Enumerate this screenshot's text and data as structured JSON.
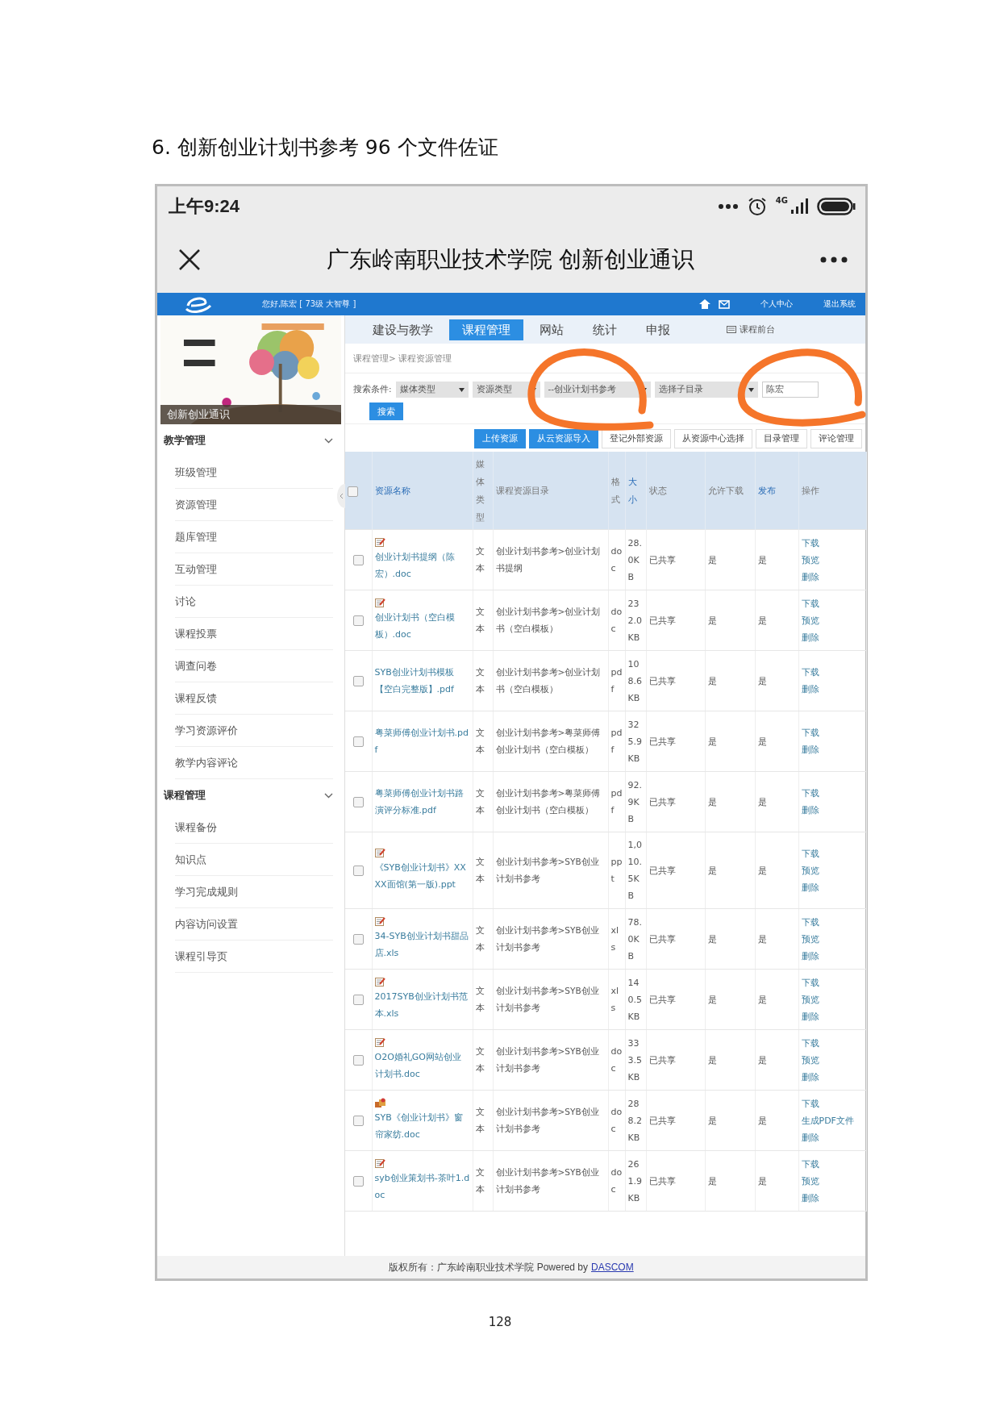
{
  "document_heading": "6. 创新创业计划书参考 96 个文件佐证",
  "status_bar": {
    "time": "上午9:24",
    "network": "4G"
  },
  "title_bar": {
    "title": "广东岭南职业技术学院 创新创业通识"
  },
  "site_header": {
    "greeting": "您好,陈宏 [ 73级 大智尊 ]",
    "links": [
      "个人中心",
      "退出系统"
    ]
  },
  "sidebar": {
    "banner_label": "创新创业通识",
    "sections": [
      {
        "title": "教学管理",
        "expanded": true,
        "items": [
          "班级管理",
          "资源管理",
          "题库管理",
          "互动管理",
          "讨论",
          "课程投票",
          "调查问卷",
          "课程反馈",
          "学习资源评价",
          "教学内容评论"
        ]
      },
      {
        "title": "课程管理",
        "expanded": true,
        "items": [
          "课程备份",
          "知识点",
          "学习完成规则",
          "内容访问设置",
          "课程引导页"
        ]
      }
    ]
  },
  "nav_tabs": [
    {
      "label": "建设与教学",
      "selected": false
    },
    {
      "label": "课程管理",
      "selected": true
    },
    {
      "label": "网站",
      "selected": false
    },
    {
      "label": "统计",
      "selected": false
    },
    {
      "label": "申报",
      "selected": false
    }
  ],
  "front_link": "课程前台",
  "breadcrumb": "课程管理> 课程资源管理",
  "search": {
    "label": "搜索条件:",
    "selects": [
      "媒体类型",
      "资源类型",
      "--创业计划书参考",
      "选择子目录"
    ],
    "keyword": "陈宏",
    "button": "搜索"
  },
  "actions": [
    {
      "label": "上传资源",
      "kind": "primary"
    },
    {
      "label": "从云资源导入",
      "kind": "primary"
    },
    {
      "label": "登记外部资源",
      "kind": "default"
    },
    {
      "label": "从资源中心选择",
      "kind": "default"
    },
    {
      "label": "目录管理",
      "kind": "default"
    },
    {
      "label": "评论管理",
      "kind": "default"
    }
  ],
  "table": {
    "all_checked": false,
    "columns": [
      {
        "label": "资源名称",
        "kind": "link"
      },
      {
        "label": "媒体类型",
        "kind": "plain"
      },
      {
        "label": "课程资源目录",
        "kind": "plain"
      },
      {
        "label": "格式",
        "kind": "plain"
      },
      {
        "label": "大小",
        "kind": "link"
      },
      {
        "label": "状态",
        "kind": "plain"
      },
      {
        "label": "允许下载",
        "kind": "plain"
      },
      {
        "label": "发布",
        "kind": "link"
      },
      {
        "label": "操作",
        "kind": "plain"
      }
    ],
    "rows": [
      {
        "checked": false,
        "kind": "annotated",
        "name": "创业计划书提纲（陈宏）.doc",
        "media": "文本",
        "directory": "创业计划书参考>创业计划书提纲",
        "format": "doc",
        "size": "28.0KB",
        "status": "已共享",
        "allow_download": "是",
        "published": "是",
        "ops": [
          "下载",
          "预览",
          "删除"
        ]
      },
      {
        "checked": false,
        "kind": "annotated",
        "name": "创业计划书（空白模板）.doc",
        "media": "文本",
        "directory": "创业计划书参考>创业计划书（空白模板）",
        "format": "doc",
        "size": "232.0KB",
        "status": "已共享",
        "allow_download": "是",
        "published": "是",
        "ops": [
          "下载",
          "预览",
          "删除"
        ]
      },
      {
        "checked": false,
        "kind": "plain",
        "name": "SYB创业计划书模板【空白完整版】.pdf",
        "media": "文本",
        "directory": "创业计划书参考>创业计划书（空白模板）",
        "format": "pdf",
        "size": "108.6KB",
        "status": "已共享",
        "allow_download": "是",
        "published": "是",
        "ops": [
          "下载",
          "删除"
        ]
      },
      {
        "checked": false,
        "kind": "plain",
        "name": "粤菜师傅创业计划书.pdf",
        "media": "文本",
        "directory": "创业计划书参考>粤菜师傅创业计划书（空白模板）",
        "format": "pdf",
        "size": "325.9KB",
        "status": "已共享",
        "allow_download": "是",
        "published": "是",
        "ops": [
          "下载",
          "删除"
        ]
      },
      {
        "checked": false,
        "kind": "plain",
        "name": "粤菜师傅创业计划书路演评分标准.pdf",
        "media": "文本",
        "directory": "创业计划书参考>粤菜师傅创业计划书（空白模板）",
        "format": "pdf",
        "size": "92.9KB",
        "status": "已共享",
        "allow_download": "是",
        "published": "是",
        "ops": [
          "下载",
          "删除"
        ]
      },
      {
        "checked": false,
        "kind": "annotated",
        "name": "《SYB创业计划书》XXXX面馆(第一版).ppt",
        "media": "文本",
        "directory": "创业计划书参考>SYB创业计划书参考",
        "format": "ppt",
        "size": "1,010.5KB",
        "status": "已共享",
        "allow_download": "是",
        "published": "是",
        "ops": [
          "下载",
          "预览",
          "删除"
        ]
      },
      {
        "checked": false,
        "kind": "annotated",
        "name": "34-SYB创业计划书甜品店.xls",
        "media": "文本",
        "directory": "创业计划书参考>SYB创业计划书参考",
        "format": "xls",
        "size": "78.0KB",
        "status": "已共享",
        "allow_download": "是",
        "published": "是",
        "ops": [
          "下载",
          "预览",
          "删除"
        ]
      },
      {
        "checked": false,
        "kind": "annotated",
        "name": "2017SYB创业计划书范本.xls",
        "media": "文本",
        "directory": "创业计划书参考>SYB创业计划书参考",
        "format": "xls",
        "size": "140.5KB",
        "status": "已共享",
        "allow_download": "是",
        "published": "是",
        "ops": [
          "下载",
          "预览",
          "删除"
        ]
      },
      {
        "checked": false,
        "kind": "annotated",
        "name": "O2O婚礼GO网站创业计划书.doc",
        "media": "文本",
        "directory": "创业计划书参考>SYB创业计划书参考",
        "format": "doc",
        "size": "333.5KB",
        "status": "已共享",
        "allow_download": "是",
        "published": "是",
        "ops": [
          "下载",
          "预览",
          "删除"
        ]
      },
      {
        "checked": false,
        "kind": "bundle",
        "name": "SYB《创业计划书》窗帘家纺.doc",
        "media": "文本",
        "directory": "创业计划书参考>SYB创业计划书参考",
        "format": "doc",
        "size": "288.2KB",
        "status": "已共享",
        "allow_download": "是",
        "published": "是",
        "ops": [
          "下载",
          "生成PDF文件",
          "删除"
        ]
      },
      {
        "checked": false,
        "kind": "annotated",
        "name": "syb创业策划书-茶叶1.doc",
        "media": "文本",
        "directory": "创业计划书参考>SYB创业计划书参考",
        "format": "doc",
        "size": "261.9KB",
        "status": "已共享",
        "allow_download": "是",
        "published": "是",
        "ops": [
          "下载",
          "预览",
          "删除"
        ]
      }
    ]
  },
  "footer": {
    "text": "版权所有：广东岭南职业技术学院 Powered by",
    "link": "DASCOM"
  },
  "page_number": "128"
}
